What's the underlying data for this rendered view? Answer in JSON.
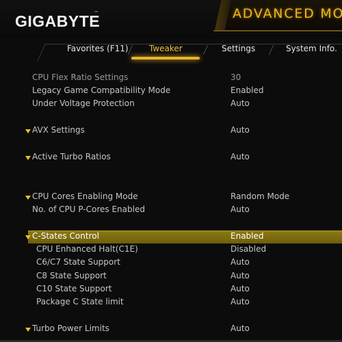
{
  "header": {
    "brand": "GIGABYTE",
    "trademark": "™",
    "mode_title": "ADVANCED MOD"
  },
  "tabs": [
    {
      "label": "Favorites (F11)",
      "active": false
    },
    {
      "label": "Tweaker",
      "active": true
    },
    {
      "label": "Settings",
      "active": false
    },
    {
      "label": "System Info.",
      "active": false
    }
  ],
  "settings": [
    {
      "label": "CPU Flex Ratio Settings",
      "value": "30"
    },
    {
      "label": "Legacy Game Compatibility Mode",
      "value": "Enabled"
    },
    {
      "label": "Under Voltage Protection",
      "value": "Auto"
    },
    {
      "label": "AVX Settings",
      "value": "Auto"
    },
    {
      "label": "Active Turbo Ratios",
      "value": "Auto"
    },
    {
      "label": "CPU Cores Enabling Mode",
      "value": "Random Mode"
    },
    {
      "label": "No. of CPU P-Cores Enabled",
      "value": "Auto"
    },
    {
      "label": "C-States Control",
      "value": "Enabled"
    },
    {
      "label": "CPU Enhanced Halt(C1E)",
      "value": "Disabled"
    },
    {
      "label": "C6/C7 State Support",
      "value": "Auto"
    },
    {
      "label": "C8 State Support",
      "value": "Auto"
    },
    {
      "label": "C10 State Support",
      "value": "Auto"
    },
    {
      "label": "Package C State limit",
      "value": "Auto"
    },
    {
      "label": "Turbo Power Limits",
      "value": "Auto"
    }
  ],
  "colors": {
    "accent": "#f0b419",
    "highlight": "#8c7a12",
    "background": "#0c0c0c"
  }
}
